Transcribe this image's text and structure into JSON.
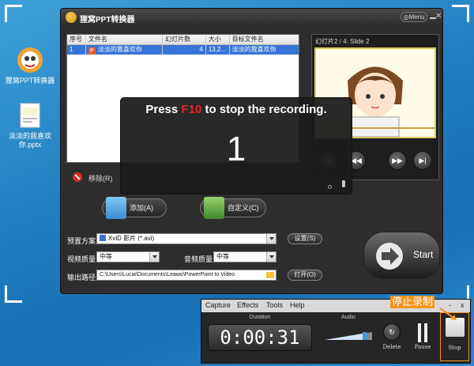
{
  "desktop": {
    "icon1_label": "狸窝PPT转换器",
    "icon2_label": "淡淡的我喜欢你.pptx"
  },
  "window": {
    "title": "狸窝PPT转换器",
    "menu_label": "Menu"
  },
  "table": {
    "headers": [
      "序号",
      "文件名",
      "幻灯片数",
      "大小",
      "目标文件名"
    ],
    "rows": [
      {
        "index": "1",
        "file": "淡淡的我喜欢你",
        "slides": "4",
        "size": "13,2...",
        "target": "淡淡的我喜欢你"
      }
    ],
    "remove_label": "移除(R)"
  },
  "preview": {
    "title": "幻灯片2 / 4: Slide 2"
  },
  "buttons": {
    "add_label": "添加(A)",
    "custom_label": "自定义(C)",
    "settings_label": "设置(S)",
    "open_label": "打开(O)",
    "start_label": "Start"
  },
  "form": {
    "preset_label": "预置方案:",
    "preset_value": "XviD 影片 (*.avi)",
    "video_quality_label": "视频质量:",
    "video_quality_value": "中等",
    "audio_quality_label": "音频质量:",
    "audio_quality_value": "中等",
    "output_label": "输出路径:",
    "output_value": "C:\\Users\\Lucia\\Documents\\Leawo\\PowerPoint to Video"
  },
  "overlay": {
    "press": "Press",
    "key": "F10",
    "rest": "to stop the recording.",
    "countdown": "1"
  },
  "recorder": {
    "menu": [
      "Capture",
      "Effects",
      "Tools",
      "Help"
    ],
    "win_min": "-",
    "win_close": "x",
    "duration_label": "Duration",
    "audio_label": "Audio",
    "timer": "0:00:31",
    "delete_label": "Delete",
    "pause_label": "Pause",
    "stop_label": "Stop",
    "volume_level": 0.85
  },
  "annotation": "停止录制",
  "colors": {
    "accent_orange": "#f7941d",
    "selection_blue": "#3874d6",
    "key_red": "#e5261f"
  }
}
